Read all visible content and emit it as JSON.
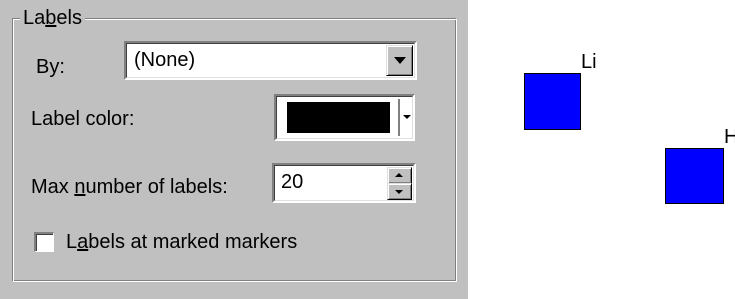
{
  "labels_group": {
    "title_pre": "La",
    "title_u": "b",
    "title_post": "els"
  },
  "by": {
    "label": "By:",
    "value": "(None)"
  },
  "label_color": {
    "label": "Label color:",
    "swatch_color": "#000000"
  },
  "max_labels": {
    "label_pre": "Max ",
    "label_u": "n",
    "label_post": "umber of labels:",
    "value": "20"
  },
  "marked_checkbox": {
    "label_pre": "L",
    "label_u": "a",
    "label_post": "bels at marked markers",
    "checked": false
  },
  "plot": {
    "marker_color": "#0000ff",
    "labels": [
      "Li",
      "H"
    ]
  }
}
